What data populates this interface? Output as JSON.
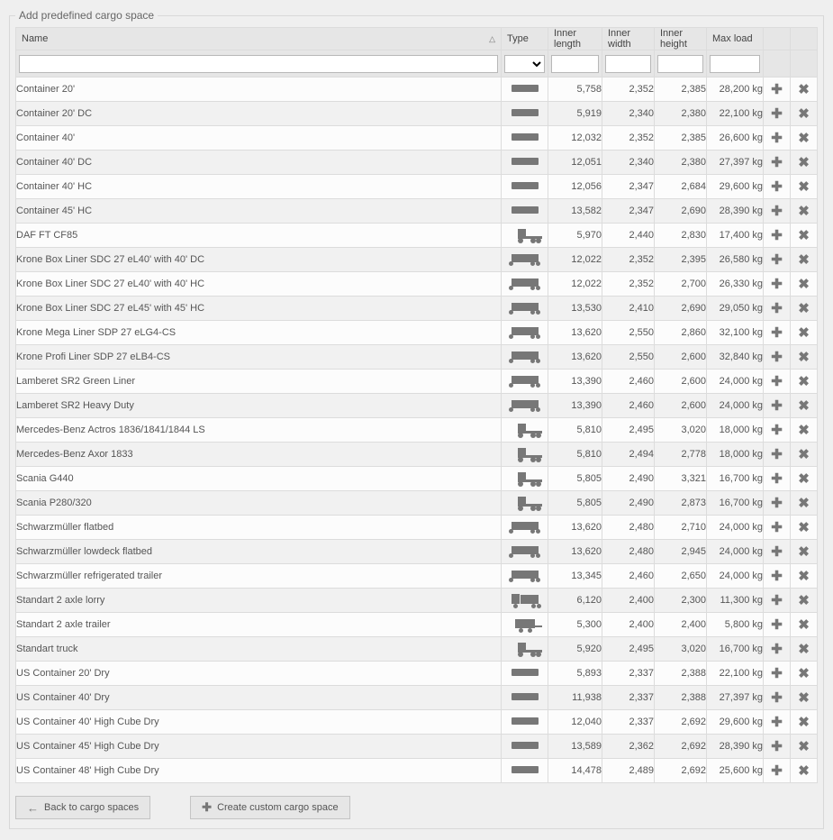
{
  "panel": {
    "title": "Add predefined cargo space"
  },
  "columns": {
    "name": "Name",
    "type": "Type",
    "inner_length": "Inner length",
    "inner_width": "Inner width",
    "inner_height": "Inner height",
    "max_load": "Max load"
  },
  "footer": {
    "back_label": "Back to cargo spaces",
    "create_label": "Create custom cargo space"
  },
  "type_icons": {
    "container": "container",
    "truckcab": "truckcab",
    "semibox": "semibox",
    "boxtruck": "boxtruck",
    "smalltrailer": "smalltrailer"
  },
  "rows": [
    {
      "name": "Container 20'",
      "type": "container",
      "length": "5,758",
      "width": "2,352",
      "height": "2,385",
      "max_load": "28,200 kg"
    },
    {
      "name": "Container 20' DC",
      "type": "container",
      "length": "5,919",
      "width": "2,340",
      "height": "2,380",
      "max_load": "22,100 kg"
    },
    {
      "name": "Container 40'",
      "type": "container",
      "length": "12,032",
      "width": "2,352",
      "height": "2,385",
      "max_load": "26,600 kg"
    },
    {
      "name": "Container 40' DC",
      "type": "container",
      "length": "12,051",
      "width": "2,340",
      "height": "2,380",
      "max_load": "27,397 kg"
    },
    {
      "name": "Container 40' HC",
      "type": "container",
      "length": "12,056",
      "width": "2,347",
      "height": "2,684",
      "max_load": "29,600 kg"
    },
    {
      "name": "Container 45' HC",
      "type": "container",
      "length": "13,582",
      "width": "2,347",
      "height": "2,690",
      "max_load": "28,390 kg"
    },
    {
      "name": "DAF FT CF85",
      "type": "truckcab",
      "length": "5,970",
      "width": "2,440",
      "height": "2,830",
      "max_load": "17,400 kg"
    },
    {
      "name": "Krone Box Liner SDC 27 eL40' with 40' DC",
      "type": "semibox",
      "length": "12,022",
      "width": "2,352",
      "height": "2,395",
      "max_load": "26,580 kg"
    },
    {
      "name": "Krone Box Liner SDC 27 eL40' with 40' HC",
      "type": "semibox",
      "length": "12,022",
      "width": "2,352",
      "height": "2,700",
      "max_load": "26,330 kg"
    },
    {
      "name": "Krone Box Liner SDC 27 eL45' with 45' HC",
      "type": "semibox",
      "length": "13,530",
      "width": "2,410",
      "height": "2,690",
      "max_load": "29,050 kg"
    },
    {
      "name": "Krone Mega Liner SDP 27 eLG4-CS",
      "type": "semibox",
      "length": "13,620",
      "width": "2,550",
      "height": "2,860",
      "max_load": "32,100 kg"
    },
    {
      "name": "Krone Profi Liner SDP 27 eLB4-CS",
      "type": "semibox",
      "length": "13,620",
      "width": "2,550",
      "height": "2,600",
      "max_load": "32,840 kg"
    },
    {
      "name": "Lamberet SR2 Green Liner",
      "type": "semibox",
      "length": "13,390",
      "width": "2,460",
      "height": "2,600",
      "max_load": "24,000 kg"
    },
    {
      "name": "Lamberet SR2 Heavy Duty",
      "type": "semibox",
      "length": "13,390",
      "width": "2,460",
      "height": "2,600",
      "max_load": "24,000 kg"
    },
    {
      "name": "Mercedes-Benz Actros 1836/1841/1844 LS",
      "type": "truckcab",
      "length": "5,810",
      "width": "2,495",
      "height": "3,020",
      "max_load": "18,000 kg"
    },
    {
      "name": "Mercedes-Benz Axor 1833",
      "type": "truckcab",
      "length": "5,810",
      "width": "2,494",
      "height": "2,778",
      "max_load": "18,000 kg"
    },
    {
      "name": "Scania G440",
      "type": "truckcab",
      "length": "5,805",
      "width": "2,490",
      "height": "3,321",
      "max_load": "16,700 kg"
    },
    {
      "name": "Scania P280/320",
      "type": "truckcab",
      "length": "5,805",
      "width": "2,490",
      "height": "2,873",
      "max_load": "16,700 kg"
    },
    {
      "name": "Schwarzmüller flatbed",
      "type": "semibox",
      "length": "13,620",
      "width": "2,480",
      "height": "2,710",
      "max_load": "24,000 kg"
    },
    {
      "name": "Schwarzmüller lowdeck flatbed",
      "type": "semibox",
      "length": "13,620",
      "width": "2,480",
      "height": "2,945",
      "max_load": "24,000 kg"
    },
    {
      "name": "Schwarzmüller refrigerated trailer",
      "type": "semibox",
      "length": "13,345",
      "width": "2,460",
      "height": "2,650",
      "max_load": "24,000 kg"
    },
    {
      "name": "Standart 2 axle lorry",
      "type": "boxtruck",
      "length": "6,120",
      "width": "2,400",
      "height": "2,300",
      "max_load": "11,300 kg"
    },
    {
      "name": "Standart 2 axle trailer",
      "type": "smalltrailer",
      "length": "5,300",
      "width": "2,400",
      "height": "2,400",
      "max_load": "5,800 kg"
    },
    {
      "name": "Standart truck",
      "type": "truckcab",
      "length": "5,920",
      "width": "2,495",
      "height": "3,020",
      "max_load": "16,700 kg"
    },
    {
      "name": "US Container 20' Dry",
      "type": "container",
      "length": "5,893",
      "width": "2,337",
      "height": "2,388",
      "max_load": "22,100 kg"
    },
    {
      "name": "US Container 40' Dry",
      "type": "container",
      "length": "11,938",
      "width": "2,337",
      "height": "2,388",
      "max_load": "27,397 kg"
    },
    {
      "name": "US Container 40' High Cube Dry",
      "type": "container",
      "length": "12,040",
      "width": "2,337",
      "height": "2,692",
      "max_load": "29,600 kg"
    },
    {
      "name": "US Container 45' High Cube Dry",
      "type": "container",
      "length": "13,589",
      "width": "2,362",
      "height": "2,692",
      "max_load": "28,390 kg"
    },
    {
      "name": "US Container 48' High Cube Dry",
      "type": "container",
      "length": "14,478",
      "width": "2,489",
      "height": "2,692",
      "max_load": "25,600 kg"
    }
  ]
}
